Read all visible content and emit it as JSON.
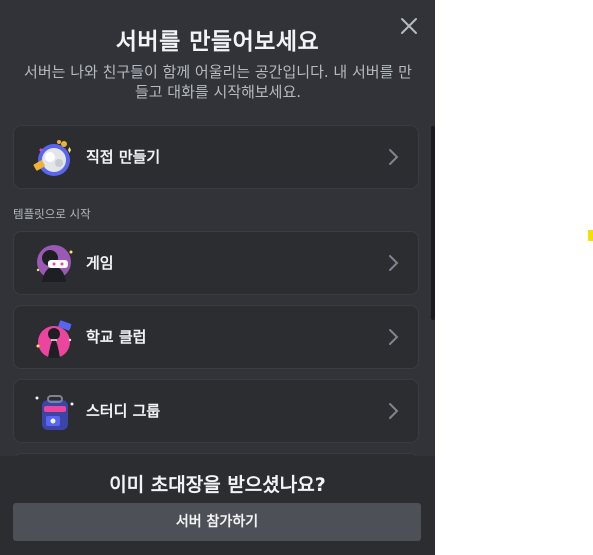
{
  "modal": {
    "title": "서버를 만들어보세요",
    "subtitle": "서버는 나와 친구들이 함께 어울리는 공간입니다. 내 서버를 만들고 대화를 시작해보세요.",
    "close_icon": "close-icon"
  },
  "create": {
    "label": "직접 만들기",
    "icon": "create-server-icon"
  },
  "templates": {
    "section_label": "템플릿으로 시작",
    "items": [
      {
        "label": "게임",
        "icon": "gaming-icon"
      },
      {
        "label": "학교 클럽",
        "icon": "school-club-icon"
      },
      {
        "label": "스터디 그룹",
        "icon": "study-group-icon"
      }
    ]
  },
  "footer": {
    "title": "이미 초대장을 받으셨나요?",
    "join_label": "서버 참가하기"
  },
  "colors": {
    "modal_bg": "#313338",
    "card_bg": "#2b2d31",
    "button_bg": "#4e5058",
    "text": "#f2f3f5",
    "muted": "#b5bac1"
  }
}
